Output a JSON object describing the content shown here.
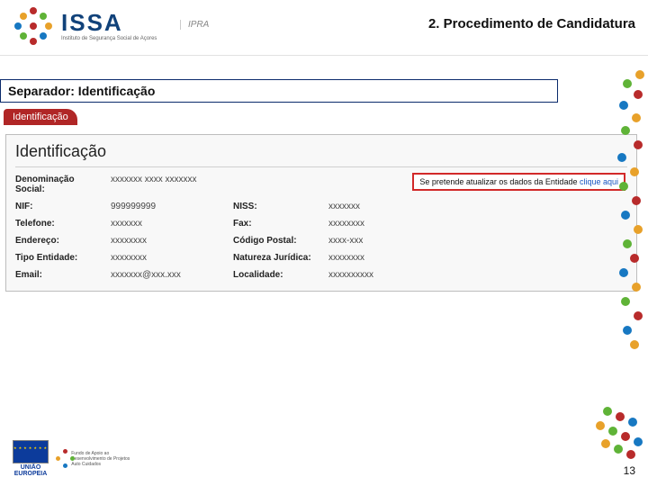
{
  "header": {
    "title": "2. Procedimento de Candidatura",
    "logo_main": "ISSA",
    "logo_sub": "Instituto de Segurança Social de Açores",
    "logo_ipra": "IPRA"
  },
  "section": {
    "title": "Separador: Identificação"
  },
  "tab": {
    "label": "Identificação"
  },
  "card": {
    "title": "Identificação",
    "fields": {
      "denominacao_label": "Denominação Social:",
      "denominacao_value": "xxxxxxx xxxx xxxxxxx",
      "nif_label": "NIF:",
      "nif_value": "999999999",
      "niss_label": "NISS:",
      "niss_value": "xxxxxxx",
      "telefone_label": "Telefone:",
      "telefone_value": "xxxxxxx",
      "fax_label": "Fax:",
      "fax_value": "xxxxxxxx",
      "endereco_label": "Endereço:",
      "endereco_value": "xxxxxxxx",
      "codigo_postal_label": "Código Postal:",
      "codigo_postal_value": "xxxx-xxx",
      "tipo_entidade_label": "Tipo Entidade:",
      "tipo_entidade_value": "xxxxxxxx",
      "natureza_label": "Natureza Jurídica:",
      "natureza_value": "xxxxxxxx",
      "email_label": "Email:",
      "email_value": "xxxxxxx@xxx.xxx",
      "localidade_label": "Localidade:",
      "localidade_value": "xxxxxxxxxx"
    },
    "update_notice_text": "Se pretende atualizar os dados da Entidade ",
    "update_notice_link": "clique aqui"
  },
  "footer": {
    "eu_label": "UNIÃO EUROPEIA",
    "fund_text": "Fundo de Apoio ao Desenvolvimento de Projetos Auto Cuidados",
    "page_number": "13"
  }
}
